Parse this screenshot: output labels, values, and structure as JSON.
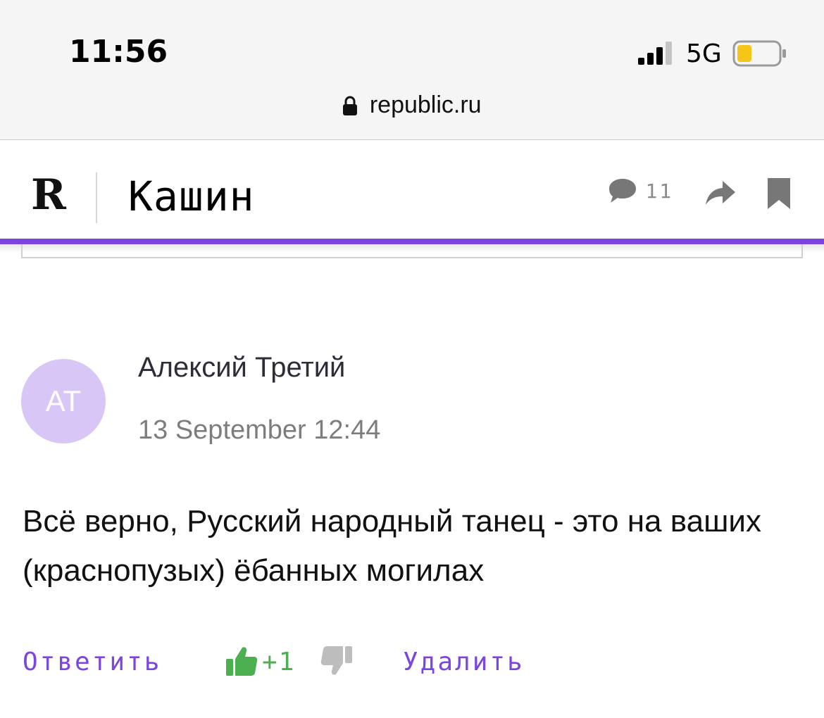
{
  "status_bar": {
    "time": "11:56",
    "network": "5G",
    "battery_level": 0.35,
    "battery_color": "#f5c518"
  },
  "browser": {
    "url": "republic.ru",
    "lock_icon": "lock-icon"
  },
  "header": {
    "logo": "R",
    "section_title": "Кашин",
    "comments_count": "11",
    "accent_color": "#7b45e0",
    "icons": [
      "comment-icon",
      "share-icon",
      "bookmark-icon"
    ]
  },
  "comment": {
    "avatar_initials": "АТ",
    "avatar_color": "#d8c6f7",
    "author": "Алексий Третий",
    "date": "13 September 12:44",
    "text": "Всё верно, Русский народный танец - это на ваших (краснопузых) ёбанных могилах",
    "actions": {
      "reply": "Ответить",
      "likes": "+1",
      "delete": "Удалить"
    },
    "colors": {
      "action": "#7b45e0",
      "like": "#4caf50",
      "dislike": "#bdbdbd"
    }
  }
}
